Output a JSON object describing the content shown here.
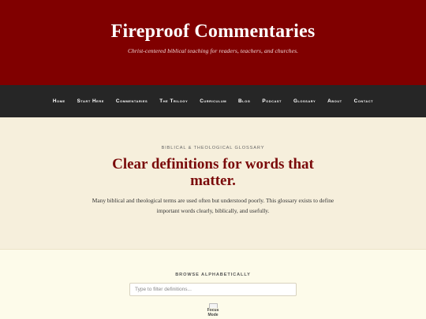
{
  "header": {
    "site_title": "Fireproof Commentaries",
    "tagline": "Christ-centered biblical teaching for readers, teachers, and churches."
  },
  "nav": {
    "items": [
      {
        "label": "Home"
      },
      {
        "label": "Start Here"
      },
      {
        "label": "Commentaries"
      },
      {
        "label": "The Trilogy"
      },
      {
        "label": "Curriculum"
      },
      {
        "label": "Blog"
      },
      {
        "label": "Podcast"
      },
      {
        "label": "Glossary"
      },
      {
        "label": "About"
      },
      {
        "label": "Contact"
      }
    ]
  },
  "hero": {
    "eyebrow": "Biblical & Theological Glossary",
    "title": "Clear definitions for words that matter.",
    "text": "Many biblical and theological terms are used often but understood poorly. This glossary exists to define important words clearly, biblically, and usefully."
  },
  "browse": {
    "label": "Browse Alphabetically",
    "filter_placeholder": "Type to filter definitions...",
    "focus_mode_label": "Focus Mode"
  },
  "colors": {
    "brand_red": "#800000",
    "nav_bg": "#262626",
    "hero_bg": "#f6efdc",
    "page_bg": "#fdfbea",
    "title_red": "#7a0a0a"
  }
}
